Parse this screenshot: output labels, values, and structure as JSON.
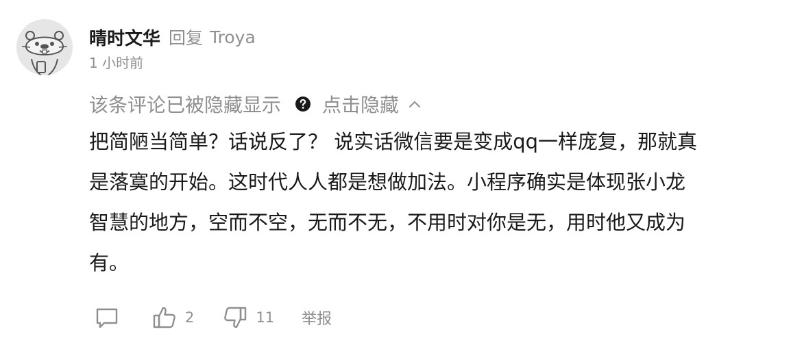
{
  "comment": {
    "avatar_icon": "otter-avatar-icon",
    "username": "晴时文华",
    "reply_word": "回复",
    "reply_target": "Troya",
    "timestamp": "1 小时前",
    "hidden_notice": {
      "text": "该条评论已被隐藏显示",
      "help_icon": "question-circle-icon",
      "toggle_label": "点击隐藏",
      "toggle_icon": "chevron-up-icon"
    },
    "body_lines": [
      "把简陋当简单？话说反了？ 说实话微信要是变成qq一样庞复，那就真",
      "是落寞的开始。这时代人人都是想做加法。小程序确实是体现张小龙",
      "智慧的地方，空而不空，无而不无，不用时对你是无，用时他又成为",
      "有。"
    ],
    "actions": {
      "comment_icon": "comment-bubble-icon",
      "like_icon": "thumbs-up-icon",
      "like_count": "2",
      "dislike_icon": "thumbs-down-icon",
      "dislike_count": "11",
      "report_label": "举报"
    }
  },
  "colors": {
    "primary_text": "#1a1a1a",
    "secondary_text": "#8f8f8f",
    "avatar_bg": "#e6e6e6"
  }
}
